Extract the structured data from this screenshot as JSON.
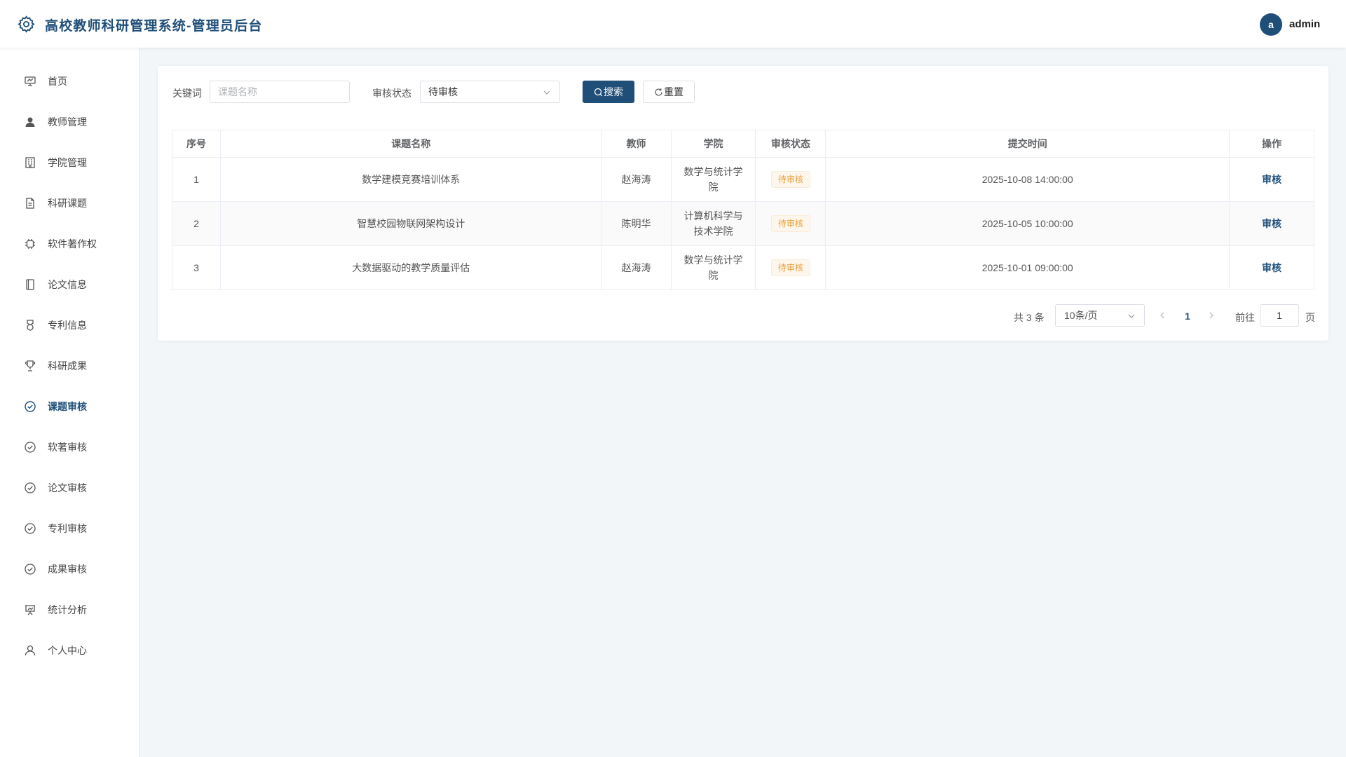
{
  "header": {
    "title": "高校教师科研管理系统-管理员后台",
    "avatar_letter": "a",
    "username": "admin"
  },
  "sidebar": {
    "items": [
      {
        "label": "首页",
        "icon": "monitor-icon"
      },
      {
        "label": "教师管理",
        "icon": "user-icon"
      },
      {
        "label": "学院管理",
        "icon": "building-icon"
      },
      {
        "label": "科研课题",
        "icon": "document-icon"
      },
      {
        "label": "软件著作权",
        "icon": "chip-icon"
      },
      {
        "label": "论文信息",
        "icon": "notebook-icon"
      },
      {
        "label": "专利信息",
        "icon": "medal-icon"
      },
      {
        "label": "科研成果",
        "icon": "trophy-icon"
      },
      {
        "label": "课题审核",
        "icon": "circle-check-icon"
      },
      {
        "label": "软著审核",
        "icon": "circle-check-icon"
      },
      {
        "label": "论文审核",
        "icon": "circle-check-icon"
      },
      {
        "label": "专利审核",
        "icon": "circle-check-icon"
      },
      {
        "label": "成果审核",
        "icon": "circle-check-icon"
      },
      {
        "label": "统计分析",
        "icon": "presentation-icon"
      },
      {
        "label": "个人中心",
        "icon": "person-outline-icon"
      }
    ],
    "active_index": 8
  },
  "filter": {
    "keyword_label": "关键词",
    "keyword_placeholder": "课题名称",
    "keyword_value": "",
    "status_label": "审核状态",
    "status_value": "待审核",
    "search_label": "搜索",
    "reset_label": "重置"
  },
  "table": {
    "headers": [
      "序号",
      "课题名称",
      "教师",
      "学院",
      "审核状态",
      "提交时间",
      "操作"
    ],
    "rows": [
      {
        "index": "1",
        "name": "数学建模竞赛培训体系",
        "teacher": "赵海涛",
        "college_line1": "数学与统计学",
        "college_line2": "院",
        "status": "待审核",
        "time": "2025-10-08 14:00:00",
        "action": "审核"
      },
      {
        "index": "2",
        "name": "智慧校园物联网架构设计",
        "teacher": "陈明华",
        "college_line1": "计算机科学与",
        "college_line2": "技术学院",
        "status": "待审核",
        "time": "2025-10-05 10:00:00",
        "action": "审核"
      },
      {
        "index": "3",
        "name": "大数据驱动的教学质量评估",
        "teacher": "赵海涛",
        "college_line1": "数学与统计学",
        "college_line2": "院",
        "status": "待审核",
        "time": "2025-10-01 09:00:00",
        "action": "审核"
      }
    ]
  },
  "pagination": {
    "total_text": "共 3 条",
    "page_size": "10条/页",
    "current_page": "1",
    "goto_label": "前往",
    "goto_value": "1",
    "unit_label": "页"
  },
  "colors": {
    "brand": "#1f4e79",
    "pending_tag_text": "#e6a23c",
    "pending_tag_bg": "#fdf6ec",
    "page_bg": "#f3f6f9"
  }
}
